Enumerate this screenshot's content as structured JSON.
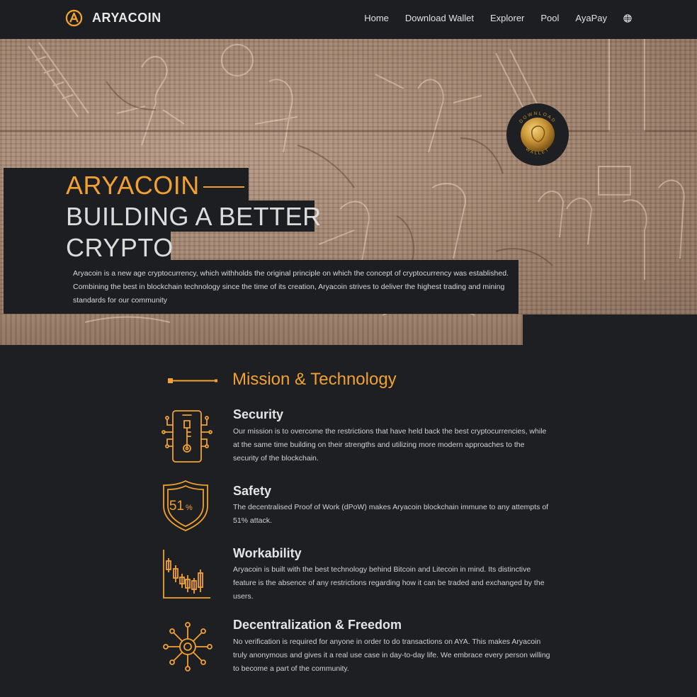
{
  "nav": {
    "brand": "ARYACOIN",
    "items": [
      "Home",
      "Download Wallet",
      "Explorer",
      "Pool",
      "AyaPay"
    ]
  },
  "hero": {
    "title_accent": "ARYACOIN",
    "title_line2": "BUILDING A BETTER",
    "title_line3": "CRYPTO",
    "description": "Aryacoin is a new age cryptocurrency, which withholds the original principle on which the concept of cryptocurrency was established. Combining the best in blockchain technology since the time of its creation, Aryacoin strives to deliver the highest trading and mining standards for our community",
    "badge_top": "DOWNLOAD",
    "badge_bottom": "WALLET"
  },
  "mission": {
    "title": "Mission & Technology",
    "features": [
      {
        "icon": "phone-key-icon",
        "title": "Security",
        "text": "Our mission is to overcome the restrictions that have held back the best cryptocurrencies, while at the same time building on their strengths and utilizing more modern approaches to the security of the blockchain."
      },
      {
        "icon": "shield-51-icon",
        "icon_text": "51",
        "icon_unit": "%",
        "title": "Safety",
        "text": "The decentralised Proof of Work (dPoW) makes Aryacoin blockchain immune to any attempts of 51% attack."
      },
      {
        "icon": "candlestick-chart-icon",
        "title": "Workability",
        "text": "Aryacoin is built with the best technology behind Bitcoin and Litecoin in mind. Its distinctive feature is the absence of any restrictions regarding how it can be traded and exchanged by the users."
      },
      {
        "icon": "network-node-icon",
        "title": "Decentralization & Freedom",
        "text": "No verification is required for anyone in order to do transactions on AYA. This makes Aryacoin truly anonymous and gives it a real use case in day-to-day life. We embrace every person willing to become a part of the community."
      }
    ]
  },
  "colors": {
    "accent": "#f1a131",
    "background": "#1e1f22",
    "nav_bg": "#1d1e21"
  }
}
